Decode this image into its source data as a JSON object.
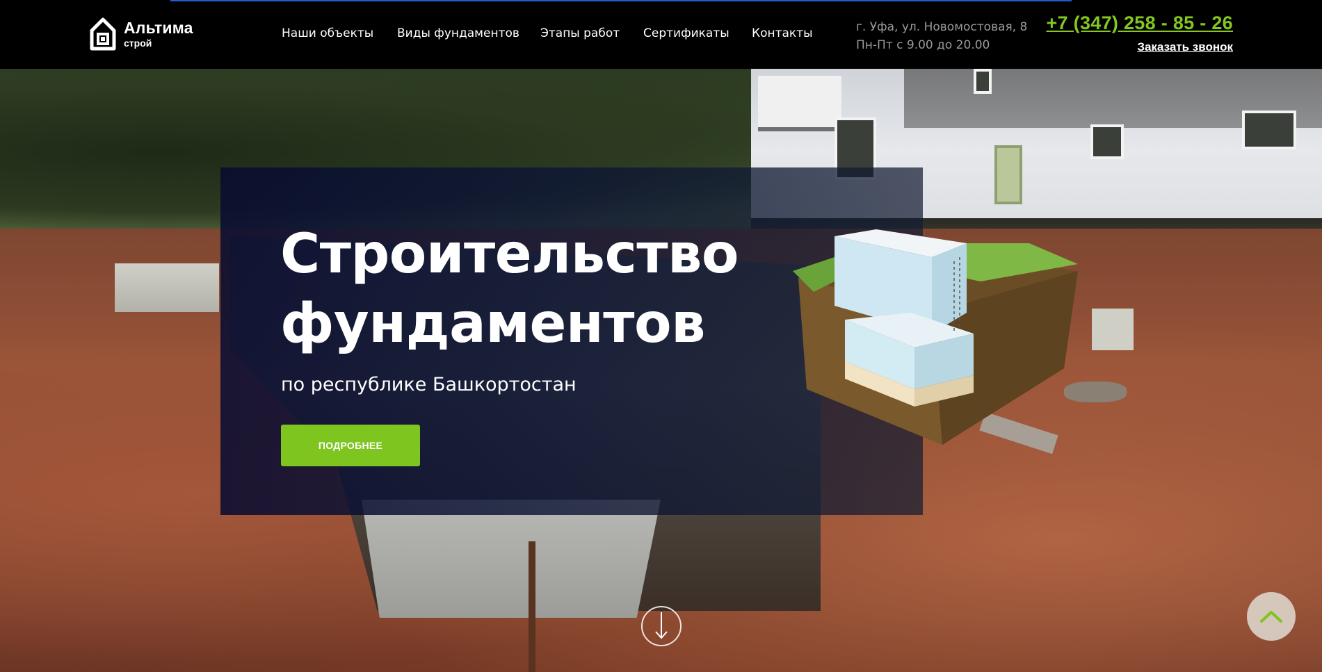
{
  "header": {
    "logo": {
      "title": "Альтима",
      "subtitle": "строй",
      "icon": "house-logo-icon"
    },
    "nav": [
      {
        "label": "Наши объекты"
      },
      {
        "label": "Виды фундаментов"
      },
      {
        "label": "Этапы работ"
      },
      {
        "label": "Сертификаты"
      },
      {
        "label": "Контакты"
      }
    ],
    "address": "г. Уфа, ул. Новомостовая, 8",
    "hours": "Пн-Пт с 9.00 до 20.00",
    "phone": "+7 (347) 258 - 85 - 26",
    "callback_label": "Заказать звонок"
  },
  "hero": {
    "title_line1": "Строительство",
    "title_line2": "фундаментов",
    "subtitle": "по республике Башкортостан",
    "button_label": "ПОДРОБНЕЕ"
  },
  "controls": {
    "scroll_down_icon": "arrow-down-circle-icon",
    "to_top_icon": "chevron-up-icon"
  },
  "colors": {
    "accent": "#7ec51f",
    "phone": "#83c720",
    "topbar": "#000000",
    "panel": "#0c1434"
  }
}
